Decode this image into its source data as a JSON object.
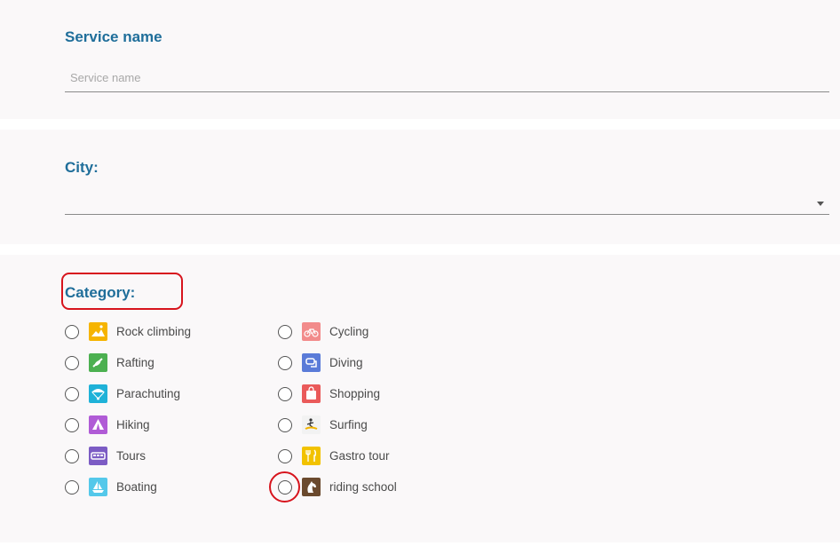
{
  "service_name": {
    "title": "Service name",
    "placeholder": "Service name"
  },
  "city": {
    "title": "City:"
  },
  "category": {
    "title": "Category:",
    "left_options": [
      {
        "label": "Rock climbing",
        "icon": "rock-climbing-icon",
        "color": "#f6b400"
      },
      {
        "label": "Rafting",
        "icon": "rafting-icon",
        "color": "#4cb050"
      },
      {
        "label": "Parachuting",
        "icon": "parachute-icon",
        "color": "#1fb2d8"
      },
      {
        "label": "Hiking",
        "icon": "tent-icon",
        "color": "#b05bd6"
      },
      {
        "label": "Tours",
        "icon": "bus-icon",
        "color": "#7c5cc4"
      },
      {
        "label": "Boating",
        "icon": "sailboat-icon",
        "color": "#54c8ea"
      }
    ],
    "right_options": [
      {
        "label": "Cycling",
        "icon": "bicycle-icon",
        "color": "#f28b8b"
      },
      {
        "label": "Diving",
        "icon": "diving-icon",
        "color": "#5a7bd8"
      },
      {
        "label": "Shopping",
        "icon": "shopping-bag-icon",
        "color": "#ea5a5a"
      },
      {
        "label": "Surfing",
        "icon": "surfing-icon",
        "color": "#f2f2f2"
      },
      {
        "label": "Gastro tour",
        "icon": "cutlery-icon",
        "color": "#f2c200"
      },
      {
        "label": "riding school",
        "icon": "horse-icon",
        "color": "#6b4a2e"
      }
    ]
  },
  "colors": {
    "heading": "#1f6e9a",
    "annotation": "#d7141d",
    "section_bg": "#faf8f9"
  }
}
